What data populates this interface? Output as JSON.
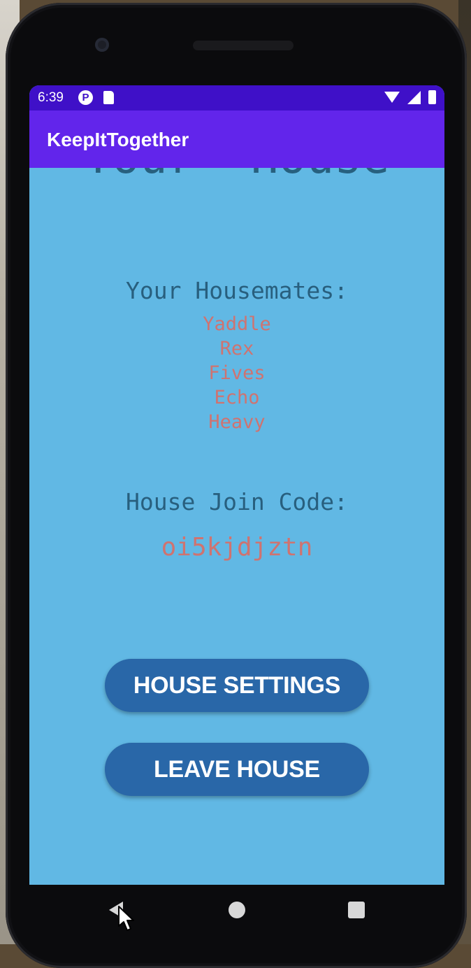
{
  "status_bar": {
    "time": "6:39",
    "notification_icon": "P"
  },
  "app_bar": {
    "title": "KeepItTogether"
  },
  "main": {
    "page_title": "Your  House",
    "housemates_label": "Your Housemates:",
    "housemates": [
      "Yaddle",
      "Rex",
      "Fives",
      "Echo",
      "Heavy"
    ],
    "join_code_label": "House Join Code:",
    "join_code": "oi5kjdjztn",
    "house_settings_button": "HOUSE SETTINGS",
    "leave_house_button": "LEAVE HOUSE"
  },
  "colors": {
    "status_bar": "#3f10c8",
    "app_bar": "#6225eb",
    "background": "#61b8e4",
    "label_text": "#285f7e",
    "accent_text": "#cf7370",
    "button": "#2967a8"
  },
  "icons": {
    "status": [
      "p-app-icon",
      "sd-card-icon",
      "wifi-icon",
      "signal-icon",
      "battery-icon"
    ],
    "navigation": [
      "back-icon",
      "home-icon",
      "recents-icon"
    ]
  }
}
